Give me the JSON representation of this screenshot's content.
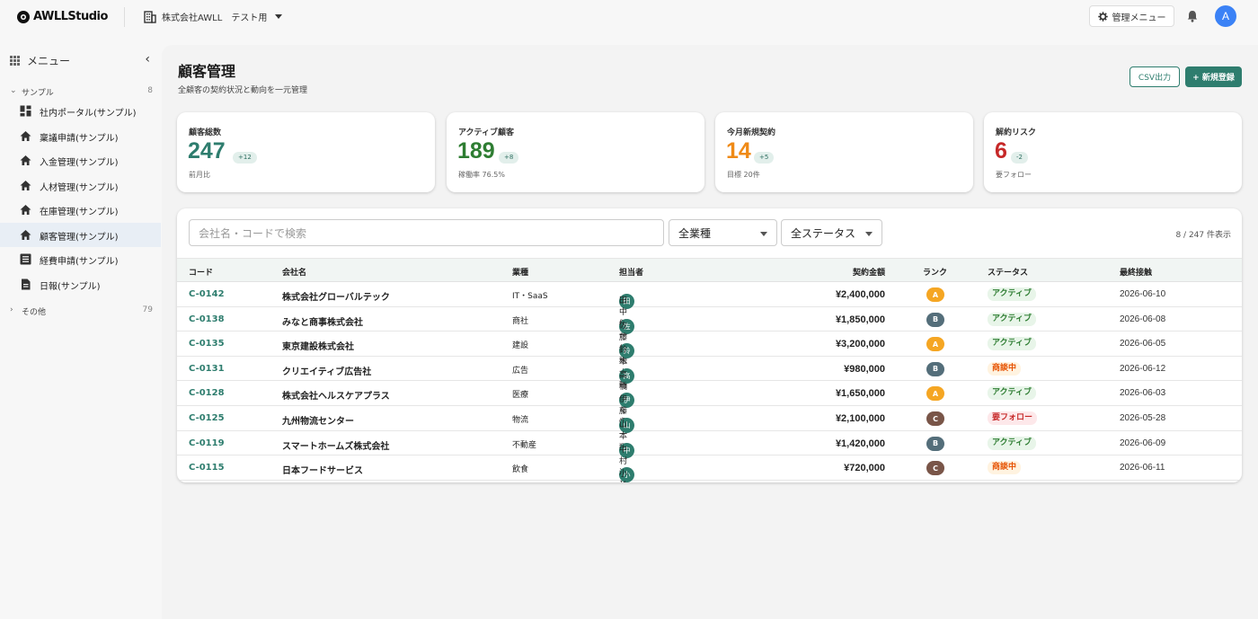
{
  "header": {
    "brand": "AWLLStudio",
    "org_name": "株式会社AWLL",
    "org_env": "テスト用",
    "admin_menu": "管理メニュー",
    "avatar_initial": "A"
  },
  "sidebar": {
    "title": "メニュー",
    "groups": [
      {
        "label": "サンプル",
        "count": "8",
        "expanded": true
      },
      {
        "label": "その他",
        "count": "79",
        "expanded": false
      }
    ],
    "items": [
      {
        "label": "社内ポータル(サンプル)",
        "icon": "dashboard-icon"
      },
      {
        "label": "稟議申請(サンプル)",
        "icon": "home-icon"
      },
      {
        "label": "入金管理(サンプル)",
        "icon": "home-icon"
      },
      {
        "label": "人材管理(サンプル)",
        "icon": "home-icon"
      },
      {
        "label": "在庫管理(サンプル)",
        "icon": "home-icon"
      },
      {
        "label": "顧客管理(サンプル)",
        "icon": "home-icon",
        "active": true
      },
      {
        "label": "経費申請(サンプル)",
        "icon": "list-icon"
      },
      {
        "label": "日報(サンプル)",
        "icon": "document-icon"
      }
    ]
  },
  "page": {
    "title": "顧客管理",
    "subtitle": "全顧客の契約状況と動向を一元管理",
    "csv_button": "CSV出力",
    "new_button": "+ 新規登録"
  },
  "stats": [
    {
      "label": "顧客総数",
      "value": "247",
      "badge": "+12",
      "note": "前月比",
      "color": "#2e7d6e"
    },
    {
      "label": "アクティブ顧客",
      "value": "189",
      "badge": "+8",
      "note": "稼働率 76.5%",
      "color": "#2e7d32"
    },
    {
      "label": "今月新規契約",
      "value": "14",
      "badge": "+5",
      "note": "目標 20件",
      "color": "#ef8a16"
    },
    {
      "label": "解約リスク",
      "value": "6",
      "badge": "-2",
      "note": "要フォロー",
      "color": "#c62828"
    }
  ],
  "filters": {
    "search_placeholder": "会社名・コードで検索",
    "industry": "全業種",
    "status": "全ステータス",
    "count_text": "8 / 247 件表示"
  },
  "table": {
    "headers": [
      "コード",
      "会社名",
      "業種",
      "担当者",
      "契約金額",
      "ランク",
      "ステータス",
      "最終接触"
    ],
    "rows": [
      {
        "code": "C-0142",
        "company": "株式会社グローバルテック",
        "industry": "IT・SaaS",
        "owner_initial": "田",
        "owner": "田中 健一",
        "amount": "¥2,400,000",
        "rank": "A",
        "status": "アクティブ",
        "date": "2026-06-10"
      },
      {
        "code": "C-0138",
        "company": "みなと商事株式会社",
        "industry": "商社",
        "owner_initial": "佐",
        "owner": "佐藤 美穂",
        "amount": "¥1,850,000",
        "rank": "B",
        "status": "アクティブ",
        "date": "2026-06-08"
      },
      {
        "code": "C-0135",
        "company": "東京建設株式会社",
        "industry": "建設",
        "owner_initial": "鈴",
        "owner": "鈴木 大輔",
        "amount": "¥3,200,000",
        "rank": "A",
        "status": "アクティブ",
        "date": "2026-06-05"
      },
      {
        "code": "C-0131",
        "company": "クリエイティブ広告社",
        "industry": "広告",
        "owner_initial": "高",
        "owner": "高橋 さくら",
        "amount": "¥980,000",
        "rank": "B",
        "status": "商談中",
        "date": "2026-06-12"
      },
      {
        "code": "C-0128",
        "company": "株式会社ヘルスケアプラス",
        "industry": "医療",
        "owner_initial": "伊",
        "owner": "伊藤 慎一",
        "amount": "¥1,650,000",
        "rank": "A",
        "status": "アクティブ",
        "date": "2026-06-03"
      },
      {
        "code": "C-0125",
        "company": "九州物流センター",
        "industry": "物流",
        "owner_initial": "山",
        "owner": "山本 翔",
        "amount": "¥2,100,000",
        "rank": "C",
        "status": "要フォロー",
        "date": "2026-05-28"
      },
      {
        "code": "C-0119",
        "company": "スマートホームズ株式会社",
        "industry": "不動産",
        "owner_initial": "中",
        "owner": "中村 涼子",
        "amount": "¥1,420,000",
        "rank": "B",
        "status": "アクティブ",
        "date": "2026-06-09"
      },
      {
        "code": "C-0115",
        "company": "日本フードサービス",
        "industry": "飲食",
        "owner_initial": "小",
        "owner": "小林 修",
        "amount": "¥720,000",
        "rank": "C",
        "status": "商談中",
        "date": "2026-06-11"
      }
    ]
  },
  "colors": {
    "accent": "#2e7d6e",
    "rank_A": "#f5a623",
    "rank_B": "#546e7a",
    "rank_C": "#795548",
    "status_active_bg": "#e8f5e9",
    "status_active_fg": "#2e7d32",
    "status_deal_bg": "#fff3e0",
    "status_deal_fg": "#e65100",
    "status_follow_bg": "#fde8ea",
    "status_follow_fg": "#c62828"
  }
}
